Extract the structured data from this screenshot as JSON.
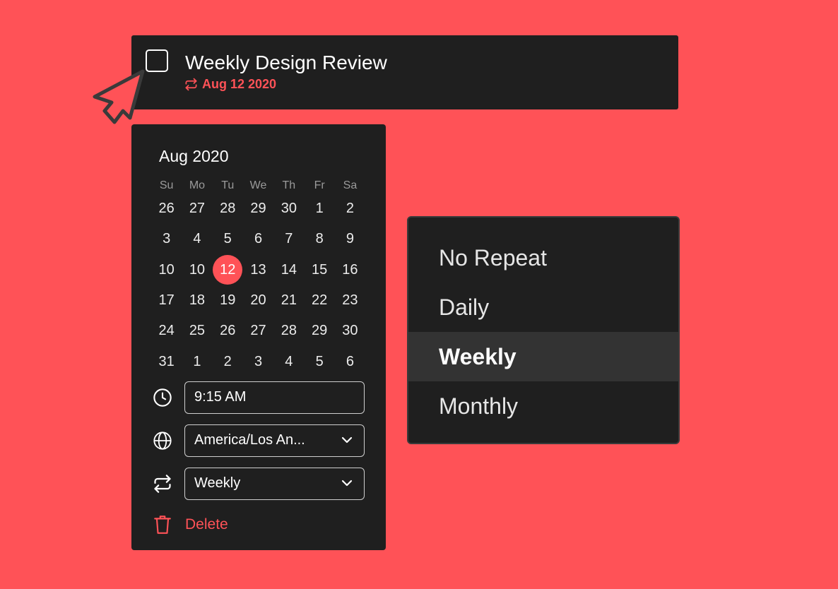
{
  "colors": {
    "background": "#ff5257",
    "panel": "#1f1f1f",
    "accent": "#ff5257",
    "text": "#ffffff",
    "muted": "#9a9a9a"
  },
  "task": {
    "title": "Weekly Design Review",
    "date": "Aug 12 2020",
    "repeat_icon": "repeat-icon",
    "checked": false
  },
  "calendar": {
    "month_title": "Aug 2020",
    "weekdays": [
      "Su",
      "Mo",
      "Tu",
      "We",
      "Th",
      "Fr",
      "Sa"
    ],
    "days": [
      "26",
      "27",
      "28",
      "29",
      "30",
      "1",
      "2",
      "3",
      "4",
      "5",
      "6",
      "7",
      "8",
      "9",
      "10",
      "10",
      "12",
      "13",
      "14",
      "15",
      "16",
      "17",
      "18",
      "19",
      "20",
      "21",
      "22",
      "23",
      "24",
      "25",
      "26",
      "27",
      "28",
      "29",
      "30",
      "31",
      "1",
      "2",
      "3",
      "4",
      "5",
      "6"
    ],
    "selected_index": 16,
    "time": {
      "icon": "clock-icon",
      "value": "9:15 AM"
    },
    "timezone": {
      "icon": "globe-icon",
      "value": "America/Los An..."
    },
    "repeat": {
      "icon": "repeat-icon",
      "value": "Weekly"
    },
    "delete": {
      "icon": "trash-icon",
      "label": "Delete"
    }
  },
  "repeat_menu": {
    "options": [
      "No Repeat",
      "Daily",
      "Weekly",
      "Monthly"
    ],
    "active_index": 2
  }
}
